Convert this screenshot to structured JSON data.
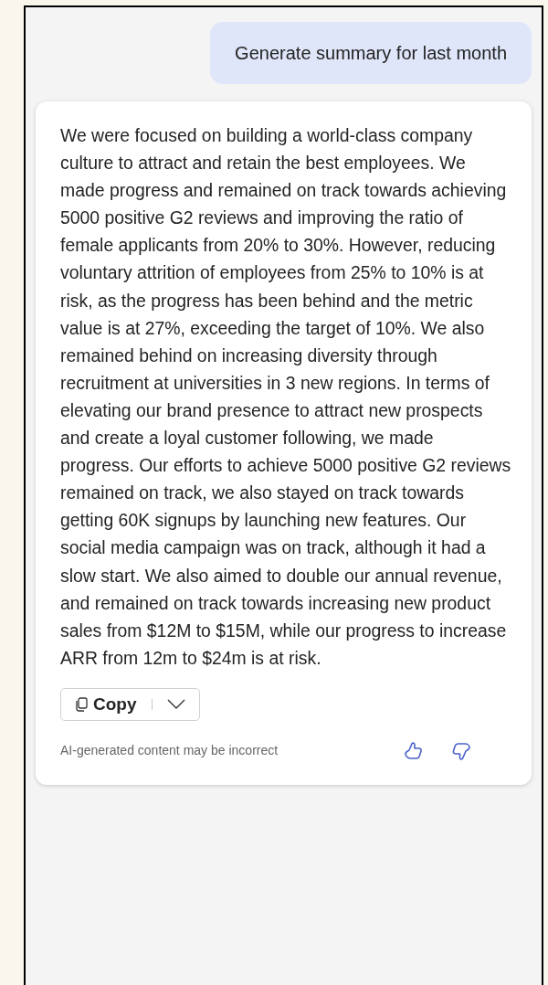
{
  "user_message": "Generate summary for last month",
  "response": {
    "text": "We were focused on building a world-class company culture to attract and retain the best employees. We made progress and remained on track towards achieving 5000 positive G2 reviews and improving the ratio of female applicants from 20% to 30%. However, reducing voluntary attrition of employees from 25% to 10% is at risk, as the progress has been behind and the metric value is at 27%, exceeding the target of 10%. We also remained behind on increasing diversity through recruitment at universities in 3 new regions. In terms of elevating our brand presence to attract new prospects and create a loyal customer following, we made progress. Our efforts to achieve 5000 positive G2 reviews remained on track, we also stayed on track towards getting 60K signups by launching new features. Our social media campaign was on track, although it had a slow start. We also aimed to double our annual revenue, and remained on track towards increasing new product sales from $12M to $15M, while our progress to increase ARR from 12m to $24m is at risk.",
    "copy_button": "Copy",
    "disclaimer": "AI-generated content may be incorrect"
  }
}
